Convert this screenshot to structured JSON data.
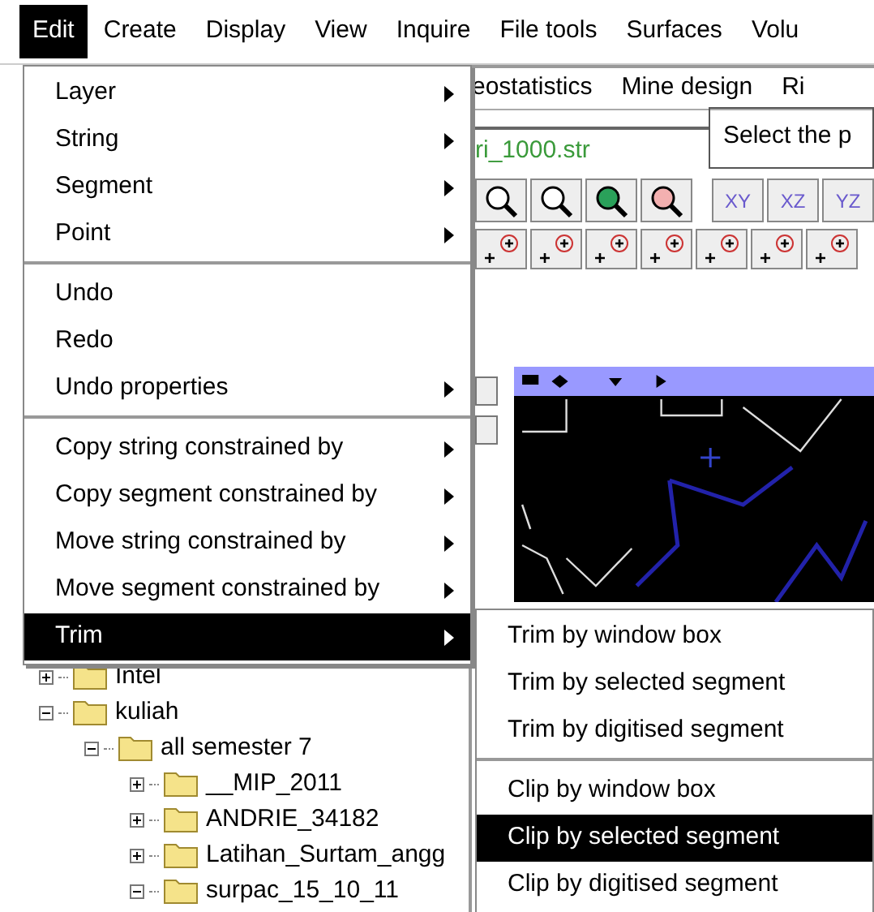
{
  "menubar": [
    {
      "label": "Edit",
      "selected": true
    },
    {
      "label": "Create",
      "selected": false
    },
    {
      "label": "Display",
      "selected": false
    },
    {
      "label": "View",
      "selected": false
    },
    {
      "label": "Inquire",
      "selected": false
    },
    {
      "label": "File tools",
      "selected": false
    },
    {
      "label": "Surfaces",
      "selected": false
    },
    {
      "label": "Volu",
      "selected": false
    }
  ],
  "app": {
    "menubar": [
      "eostatistics",
      "Mine design",
      "Ri"
    ],
    "file_field": "ri_1000.str",
    "prompt": "Select the p",
    "view_buttons": [
      "XY",
      "XZ",
      "YZ"
    ]
  },
  "tree": [
    {
      "label": "Intel",
      "expanded": false
    },
    {
      "label": "kuliah",
      "expanded": true,
      "children": [
        {
          "label": "all semester 7",
          "expanded": true,
          "children": [
            {
              "label": "__MIP_2011",
              "expanded": false
            },
            {
              "label": "ANDRIE_34182",
              "expanded": false
            },
            {
              "label": "Latihan_Surtam_angg",
              "expanded": false
            },
            {
              "label": "surpac_15_10_11",
              "expanded": true
            }
          ]
        }
      ]
    }
  ],
  "edit_menu": [
    {
      "kind": "item",
      "label": "Layer",
      "submenu": true,
      "selected": false
    },
    {
      "kind": "item",
      "label": "String",
      "submenu": true,
      "selected": false
    },
    {
      "kind": "item",
      "label": "Segment",
      "submenu": true,
      "selected": false
    },
    {
      "kind": "item",
      "label": "Point",
      "submenu": true,
      "selected": false
    },
    {
      "kind": "separator"
    },
    {
      "kind": "item",
      "label": "Undo",
      "submenu": false,
      "selected": false
    },
    {
      "kind": "item",
      "label": "Redo",
      "submenu": false,
      "selected": false
    },
    {
      "kind": "item",
      "label": "Undo properties",
      "submenu": true,
      "selected": false
    },
    {
      "kind": "separator"
    },
    {
      "kind": "item",
      "label": "Copy string constrained by",
      "submenu": true,
      "selected": false
    },
    {
      "kind": "item",
      "label": "Copy segment constrained by",
      "submenu": true,
      "selected": false
    },
    {
      "kind": "item",
      "label": "Move string constrained by",
      "submenu": true,
      "selected": false
    },
    {
      "kind": "item",
      "label": "Move segment constrained by",
      "submenu": true,
      "selected": false
    },
    {
      "kind": "item",
      "label": "Trim",
      "submenu": true,
      "selected": true
    }
  ],
  "trim_submenu": [
    {
      "kind": "item",
      "label": "Trim by window box",
      "selected": false
    },
    {
      "kind": "item",
      "label": "Trim by selected segment",
      "selected": false
    },
    {
      "kind": "item",
      "label": "Trim by digitised segment",
      "selected": false
    },
    {
      "kind": "separator"
    },
    {
      "kind": "item",
      "label": "Clip by window box",
      "selected": false
    },
    {
      "kind": "item",
      "label": "Clip by selected segment",
      "selected": true
    },
    {
      "kind": "item",
      "label": "Clip by digitised segment",
      "selected": false
    }
  ]
}
